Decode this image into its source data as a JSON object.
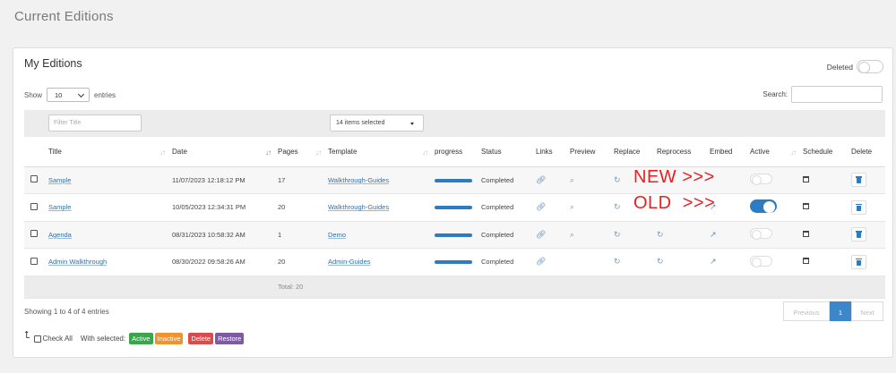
{
  "page": {
    "title": "Current Editions"
  },
  "card": {
    "title": "My Editions",
    "deleted_label": "Deleted",
    "show_label": "Show",
    "entries_value": "10",
    "entries_label": "entries",
    "search_label": "Search:",
    "filter_title_placeholder": "Filter Title",
    "template_filter_value": "14 items selected"
  },
  "table": {
    "headers": [
      "Title",
      "Date",
      "Pages",
      "Template",
      "progress",
      "Status",
      "Links",
      "Preview",
      "Replace",
      "Reprocess",
      "Embed",
      "Active",
      "Schedule",
      "Delete"
    ],
    "rows": [
      {
        "title": "Sample",
        "date": "11/07/2023 12:18:12 PM",
        "pages": "17",
        "template": "Walkthrough-Guides",
        "progress": 1,
        "status": "Completed",
        "active": false
      },
      {
        "title": "Sample",
        "date": "10/05/2023 12:34:31 PM",
        "pages": "20",
        "template": "Walkthrough-Guides",
        "progress": 1,
        "status": "Completed",
        "active": true
      },
      {
        "title": "Agenda",
        "date": "08/31/2023 10:58:32 AM",
        "pages": "1",
        "template": "Demo",
        "progress": 1,
        "status": "Completed",
        "active": false
      },
      {
        "title": "Admin Walkthrough",
        "date": "08/30/2022 09:58:26 AM",
        "pages": "20",
        "template": "Admin-Guides",
        "progress": 1,
        "status": "Completed",
        "active": false
      }
    ],
    "total": "Total: 20"
  },
  "annotations": {
    "new": "NEW >>>",
    "old": "OLD  >>>"
  },
  "footer": {
    "showing": "Showing 1 to 4 of 4 entries",
    "prev": "Previous",
    "page": "1",
    "next": "Next",
    "check_all": "Check All",
    "with_selected": "With selected:",
    "buttons": [
      {
        "label": "Active",
        "color": "#3aa64a"
      },
      {
        "label": "Inactive",
        "color": "#f0922e"
      },
      {
        "label": "Delete",
        "color": "#dc4b4b"
      },
      {
        "label": "Restore",
        "color": "#7e5aa3"
      }
    ]
  },
  "icons": {
    "link": "link-icon",
    "preview": "search-icon",
    "replace": "refresh-icon",
    "reprocess": "refresh-icon",
    "embed": "external-link-icon",
    "schedule": "calendar-icon",
    "delete": "trash-icon"
  },
  "colors": {
    "primary": "#2d7cc3",
    "link": "#2f6fa8",
    "annotation": "#e82020"
  }
}
